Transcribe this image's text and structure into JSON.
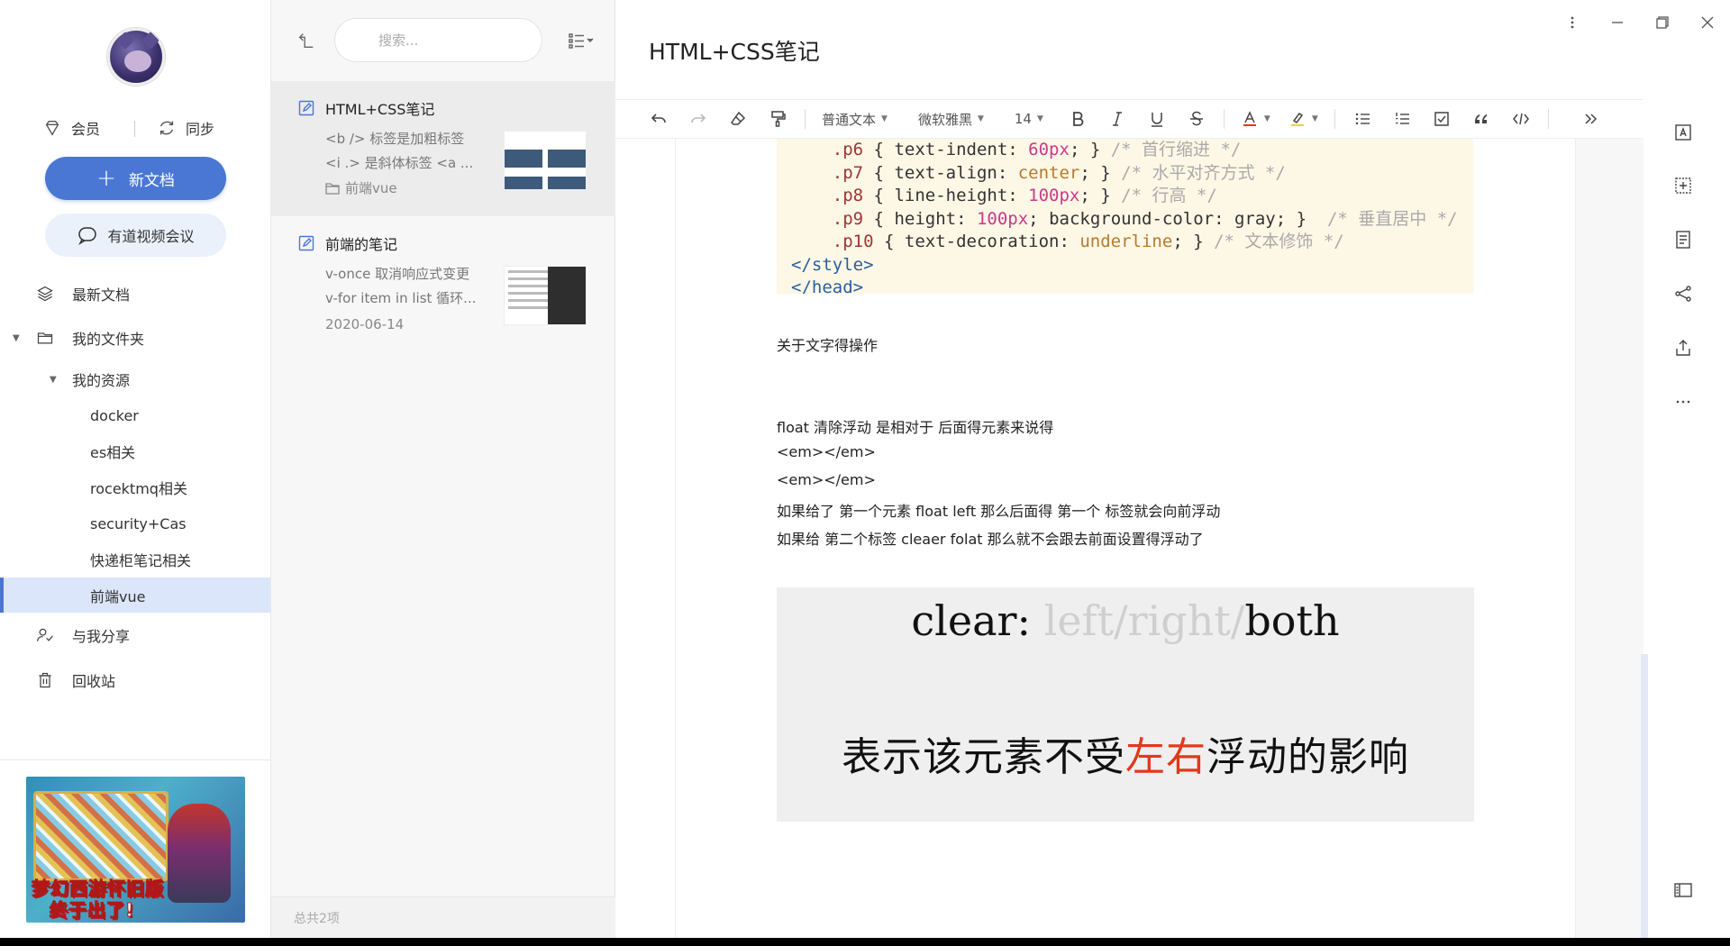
{
  "sidebar": {
    "member_label": "会员",
    "sync_label": "同步",
    "new_doc_label": "新文档",
    "meeting_label": "有道视频会议",
    "nav": {
      "recent": "最新文档",
      "my_folder": "我的文件夹",
      "my_resources": "我的资源",
      "folders": [
        "docker",
        "es相关",
        "rocektmq相关",
        "security+Cas",
        "快递柜笔记相关",
        "前端vue"
      ],
      "shared": "与我分享",
      "trash": "回收站"
    },
    "ad": {
      "line1": "梦幻西游怀旧版",
      "line2": "终于出了!"
    }
  },
  "doclist": {
    "search_placeholder": "搜索...",
    "docs": [
      {
        "title": "HTML+CSS笔记",
        "line1": "<b /> 标签是加粗标签",
        "line2": "<i .> 是斜体标签 <a ...",
        "meta": "前端vue"
      },
      {
        "title": "前端的笔记",
        "line1": "v-once 取消响应式变更",
        "line2": "v-for item in list 循环...",
        "meta": "2020-06-14"
      }
    ],
    "footer": "总共2项"
  },
  "editor": {
    "title": "HTML+CSS笔记",
    "toolbar": {
      "paragraph_style": "普通文本",
      "font": "微软雅黑",
      "font_size": "14"
    },
    "code_lines": [
      {
        "sel": ".p6",
        "prop": "text-indent",
        "val": "60px",
        "cmt": "首行缩进"
      },
      {
        "sel": ".p7",
        "prop": "text-align",
        "val": "center",
        "cmt": "水平对齐方式"
      },
      {
        "sel": ".p8",
        "prop": "line-height",
        "val": "100px",
        "cmt": "行高"
      },
      {
        "sel": ".p9",
        "prop": "height",
        "val": "100px",
        "prop2": "background-color",
        "val2": "gray",
        "cmt": "垂直居中"
      },
      {
        "sel": ".p10",
        "prop": "text-decoration",
        "val": "underline",
        "cmt": "文本修饰"
      }
    ],
    "code_close_style": "</style>",
    "code_close_head": "</head>",
    "para_heading": "关于文字得操作",
    "para_lines": [
      "float 清除浮动 是相对于 后面得元素来说得",
      "<em></em>",
      "<em></em>",
      "如果给了 第一个元素 float left 那么后面得 第一个 标签就会向前浮动",
      "如果给 第二个标签 cleaer folat 那么就不会跟去前面设置得浮动了"
    ],
    "image": {
      "prefix": "clear: ",
      "dim_text": "left/right/",
      "strong_text": "both",
      "desc_before": "表示该元素不受",
      "desc_red": "左右",
      "desc_after": "浮动的影响"
    }
  },
  "colors": {
    "accent": "#4a77d4",
    "accent_light": "#eaf1fb",
    "active_bg": "#dbe6fa",
    "red": "#e2381b"
  }
}
